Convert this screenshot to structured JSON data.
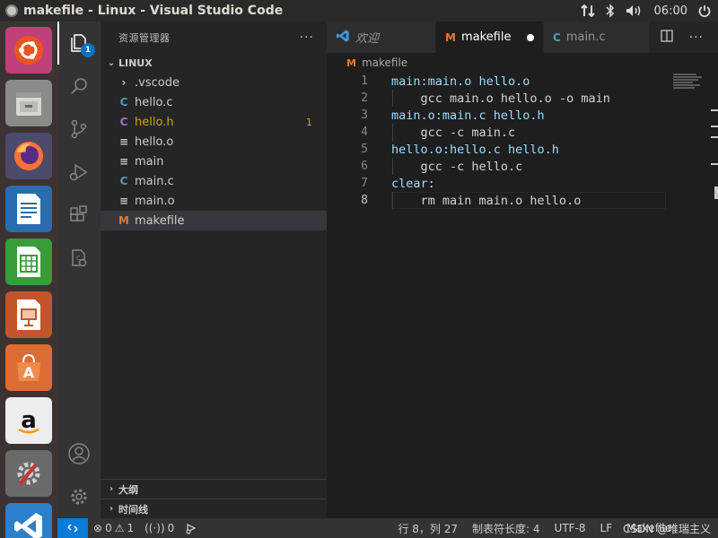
{
  "window": {
    "title": "makefile - Linux - Visual Studio Code",
    "clock": "06:00"
  },
  "launcher": {
    "apps": [
      {
        "name": "Ubuntu Dash",
        "icon": "ubuntu-icon"
      },
      {
        "name": "Files",
        "icon": "files-icon"
      },
      {
        "name": "Firefox",
        "icon": "firefox-icon"
      },
      {
        "name": "LibreOffice Writer",
        "icon": "writer-icon"
      },
      {
        "name": "LibreOffice Calc",
        "icon": "calc-icon"
      },
      {
        "name": "LibreOffice Impress",
        "icon": "impress-icon"
      },
      {
        "name": "Ubuntu Software",
        "icon": "software-icon"
      },
      {
        "name": "Amazon",
        "icon": "amazon-icon"
      },
      {
        "name": "System Settings",
        "icon": "settings-icon"
      },
      {
        "name": "Visual Studio Code",
        "icon": "vscode-icon"
      }
    ]
  },
  "activity": {
    "explorer_badge": "1"
  },
  "sidebar": {
    "title": "资源管理器",
    "more": "···",
    "folder": "LINUX",
    "files": [
      {
        "label": ".vscode",
        "kind": "folder",
        "icon": "›",
        "color": "#cccccc",
        "status": ""
      },
      {
        "label": "hello.c",
        "kind": "c",
        "icon": "C",
        "color": "#519aba",
        "status": ""
      },
      {
        "label": "hello.h",
        "kind": "h",
        "icon": "C",
        "color": "#a074c4",
        "status": "1",
        "label_color": "#cca700"
      },
      {
        "label": "hello.o",
        "kind": "o",
        "icon": "≡",
        "color": "#cccccc",
        "status": ""
      },
      {
        "label": "main",
        "kind": "bin",
        "icon": "≡",
        "color": "#cccccc",
        "status": ""
      },
      {
        "label": "main.c",
        "kind": "c",
        "icon": "C",
        "color": "#519aba",
        "status": ""
      },
      {
        "label": "main.o",
        "kind": "o",
        "icon": "≡",
        "color": "#cccccc",
        "status": ""
      },
      {
        "label": "makefile",
        "kind": "makefile",
        "icon": "M",
        "color": "#e37933",
        "status": "",
        "selected": true
      }
    ],
    "outline": "大纲",
    "timeline": "时间线"
  },
  "tabs": [
    {
      "label": "欢迎",
      "icon": "vscode-logo",
      "active": false,
      "italic": true
    },
    {
      "label": "makefile",
      "icon": "M",
      "active": true,
      "dirty": true
    },
    {
      "label": "main.c",
      "icon": "C",
      "active": false
    }
  ],
  "breadcrumb": {
    "icon": "M",
    "label": "makefile"
  },
  "code": {
    "lines": [
      {
        "n": "1",
        "text": "main:main.o hello.o",
        "target": true
      },
      {
        "n": "2",
        "text": "    gcc main.o hello.o -o main",
        "target": false
      },
      {
        "n": "3",
        "text": "main.o:main.c hello.h",
        "target": true
      },
      {
        "n": "4",
        "text": "    gcc -c main.c",
        "target": false
      },
      {
        "n": "5",
        "text": "hello.o:hello.c hello.h",
        "target": true
      },
      {
        "n": "6",
        "text": "    gcc -c hello.c",
        "target": false
      },
      {
        "n": "7",
        "text": "clear:",
        "target": true
      },
      {
        "n": "8",
        "text": "    rm main main.o hello.o",
        "target": false
      }
    ],
    "current_line": "8"
  },
  "statusbar": {
    "errors": "0",
    "warnings": "1",
    "ports": "0",
    "position": "行 8，列 27",
    "tab_size": "制表符长度: 4",
    "encoding": "UTF-8",
    "eol": "LF",
    "language": "Makefile",
    "watermark": "CSDN @唯瑞主义"
  },
  "colors": {
    "accent": "#0a7bd7",
    "badge": "#0e70c0",
    "makefile_icon": "#e37933",
    "c_icon": "#519aba",
    "h_icon": "#a074c4",
    "warning": "#cca700"
  }
}
